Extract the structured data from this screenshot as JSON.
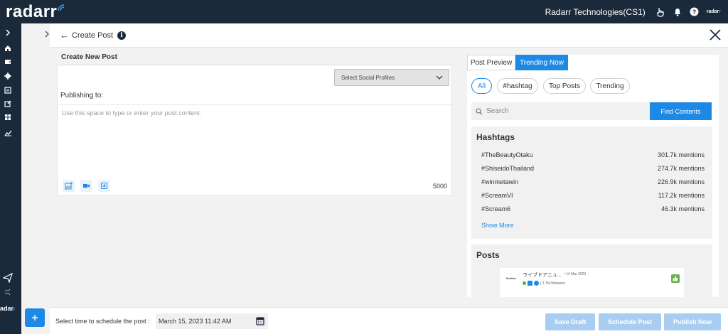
{
  "brand": {
    "logo_text": "radar",
    "logo_accent": "r"
  },
  "topbar": {
    "org_name": "Radarr Technologies(CS1)",
    "icons": [
      "hand-pointer-icon",
      "bell-icon",
      "help-icon"
    ],
    "mini_logo": "radar"
  },
  "rail": {
    "icons": [
      "home-icon",
      "inbox-icon",
      "settings-icon",
      "reports-icon",
      "compose-icon",
      "dashboard-icon",
      "analytics-icon",
      "send-icon",
      "shuffle-icon"
    ],
    "bottom_logo": "adar"
  },
  "panel": {
    "title": "Create Post",
    "back_arrow": "←"
  },
  "compose": {
    "section_title": "Create New Post",
    "select_profiles_label": "Select Social Profiles",
    "publishing_to_label": "Publishing to:",
    "placeholder": "Use this space to type or enter your post content.",
    "char_count": "5000",
    "media_buttons": [
      "add-image-icon",
      "video-icon",
      "save-draft-icon"
    ]
  },
  "right_panel": {
    "tabs": [
      "Post Preview",
      "Trending Now"
    ],
    "active_tab": "Trending Now",
    "filters": [
      "All",
      "#hashtag",
      "Top Posts",
      "Trending"
    ],
    "active_filter": "All",
    "search_placeholder": "Search",
    "find_button": "Find Contents",
    "hashtags_title": "Hashtags",
    "hashtags": [
      {
        "tag": "#TheBeautyOtaku",
        "mentions": "301.7k mentions"
      },
      {
        "tag": "#ShiseidoThailand",
        "mentions": "274.7k mentions"
      },
      {
        "tag": "#winmetawin",
        "mentions": "226.9k mentions"
      },
      {
        "tag": "#ScreamVI",
        "mentions": "117.2k mentions"
      },
      {
        "tag": "#Scream6",
        "mentions": "46.3k mentions"
      }
    ],
    "show_more": "Show More",
    "posts_title": "Posts",
    "post": {
      "avatar_text": "Smiiber",
      "title": "ライブドアニュ...",
      "date": "• 14 Mar 2023",
      "followers": "| 1.7M followers"
    }
  },
  "bottom": {
    "schedule_label": "Select time to schedule the post :",
    "schedule_value": "March 15, 2023 11:42 AM",
    "buttons": [
      "Save Draft",
      "Schedule Post",
      "Publish Now"
    ]
  },
  "colors": {
    "brand_dark": "#1b2a3b",
    "accent": "#1e88e5",
    "disabled_btn": "#a9cdf0"
  }
}
